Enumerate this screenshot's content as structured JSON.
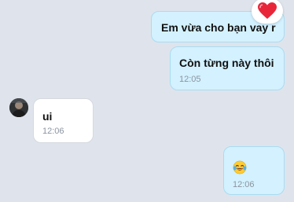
{
  "messages": [
    {
      "direction": "outgoing",
      "text": "Em vừa cho bạn vay r",
      "reaction": "heart",
      "time": ""
    },
    {
      "direction": "outgoing",
      "text": "Còn từng này thôi",
      "time": "12:05"
    },
    {
      "direction": "incoming",
      "text": "ui",
      "time": "12:06",
      "avatar": "sender-avatar"
    },
    {
      "direction": "outgoing",
      "text": "",
      "emoji": "laughing-tears-emoji",
      "time": "12:06"
    }
  ],
  "colors": {
    "background": "#dfe4ec",
    "outgoing_bubble": "#d3f1ff",
    "incoming_bubble": "#ffffff",
    "reaction_heart": "#e8263a"
  }
}
